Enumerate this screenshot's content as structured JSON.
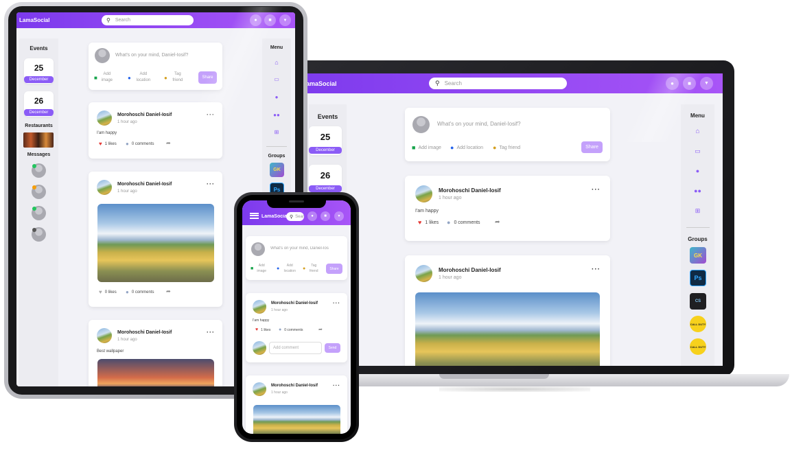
{
  "app": {
    "logo": "LamaSocial",
    "logo_laptop": "amaSocial",
    "logo_phone": "LamaSocial"
  },
  "search": {
    "placeholder": "Search"
  },
  "composer": {
    "prompt": "What's on your mind, Daniel-Iosif?",
    "prompt_phone": "What's on your mind, Daniel-Ios",
    "add_image": "Add image",
    "add_location": "Add location",
    "tag_friend": "Tag friend",
    "share": "Share"
  },
  "events": {
    "title": "Events",
    "items": [
      {
        "day": "25",
        "month": "December"
      },
      {
        "day": "26",
        "month": "December"
      }
    ]
  },
  "sidebar": {
    "restaurants": "Restaurants",
    "messages": "Messages"
  },
  "menu": {
    "title": "Menu",
    "groups_title": "Groups"
  },
  "posts": [
    {
      "author": "Morohoschi Daniel-Iosif",
      "time": "1 hour ago",
      "text": "I'am happy",
      "likes": "1 likes",
      "comments": "0 comments"
    },
    {
      "author": "Morohoschi Daniel-Iosif",
      "time": "1 hour ago",
      "text": "",
      "likes": "0 likes",
      "comments": "0 comments"
    },
    {
      "author": "Morohoschi Daniel-Iosif",
      "time": "1 hour ago",
      "text": "Best wallpaper",
      "likes": "",
      "comments": ""
    }
  ],
  "comment": {
    "placeholder": "Add comment",
    "send": "Send"
  },
  "groups": [
    "GK",
    "Ps",
    "CS",
    "CALL DUTY",
    "CALL DUTY"
  ],
  "colors": {
    "accent": "#8b5cf6",
    "like": "#e53935",
    "comment_icon": "#93a5c4",
    "online": "#22c55e",
    "away": "#f59e0b"
  }
}
